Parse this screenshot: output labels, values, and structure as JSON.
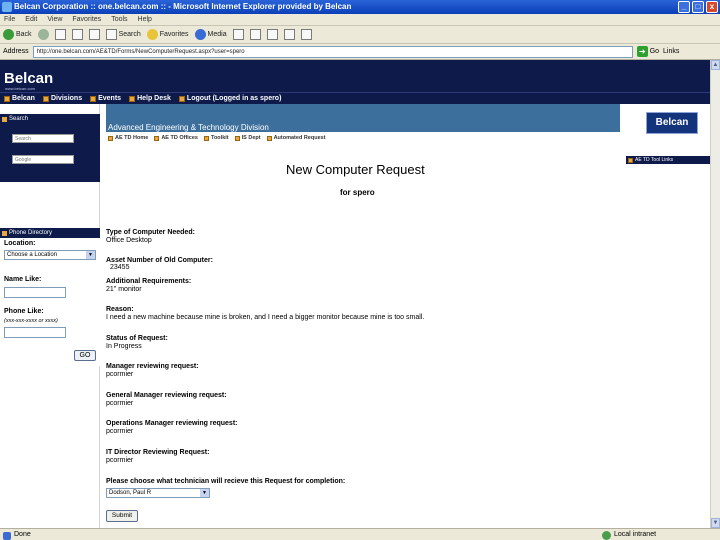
{
  "window": {
    "title": "Belcan Corporation :: one.belcan.com :: - Microsoft Internet Explorer provided by Belcan",
    "min": "_",
    "max": "□",
    "close": "x"
  },
  "menu": [
    "File",
    "Edit",
    "View",
    "Favorites",
    "Tools",
    "Help"
  ],
  "toolbar": {
    "back": "Back",
    "search": "Search",
    "favorites": "Favorites",
    "media": "Media"
  },
  "address": {
    "label": "Address",
    "url": "http://one.belcan.com/AE&TD/Forms/NewComputerRequest.aspx?user=spero",
    "go": "Go",
    "links": "Links"
  },
  "site": {
    "logo": "Belcan",
    "logo_sub": "www.belcan.com",
    "nav": [
      "Belcan",
      "Divisions",
      "Events",
      "Help Desk",
      "Logout (Logged in as spero)"
    ]
  },
  "left": {
    "search_head": "Search",
    "search_field1": "Search",
    "search_field2": "Google",
    "phone_head": "Phone Directory",
    "location_label": "Location:",
    "location_value": "Choose a Location",
    "name_label": "Name Like:",
    "phone_label": "Phone Like:",
    "phone_hint": "(xxx-xxx-xxxx or xxxx)",
    "go": "GO"
  },
  "division": {
    "title": "Advanced Engineering & Technology Division",
    "subnav": [
      "AE TD Home",
      "AE TD Offices",
      "Toolkit",
      "IS Dept",
      "Automated Request"
    ],
    "belcan_button": "Belcan",
    "right_link": "AE TD Tool Links"
  },
  "form": {
    "title": "New Computer Request",
    "subtitle": "for spero",
    "type_label": "Type of Computer Needed:",
    "type_value": "Office Desktop",
    "asset_label": "Asset Number of Old Computer:",
    "asset_value": "23455",
    "additional_label": "Additional Requirements:",
    "additional_value": "21\" monitor",
    "reason_label": "Reason:",
    "reason_value": "I need a new machine because mine is broken, and I need a bigger monitor because mine is too small.",
    "status_label": "Status of Request:",
    "status_value": "In Progress",
    "manager_label": "Manager reviewing request:",
    "manager_value": "pcormier",
    "gm_label": "General Manager reviewing request:",
    "gm_value": "pcormier",
    "ops_label": "Operations Manager reviewing request:",
    "ops_value": "pcormier",
    "it_label": "IT Director Reviewing Request:",
    "it_value": "pcormier",
    "tech_label": "Please choose what technician will recieve this Request for completion:",
    "tech_value": "Dodson, Paul R",
    "submit": "Submit"
  },
  "status": {
    "text": "Done",
    "zone": "Local intranet"
  }
}
